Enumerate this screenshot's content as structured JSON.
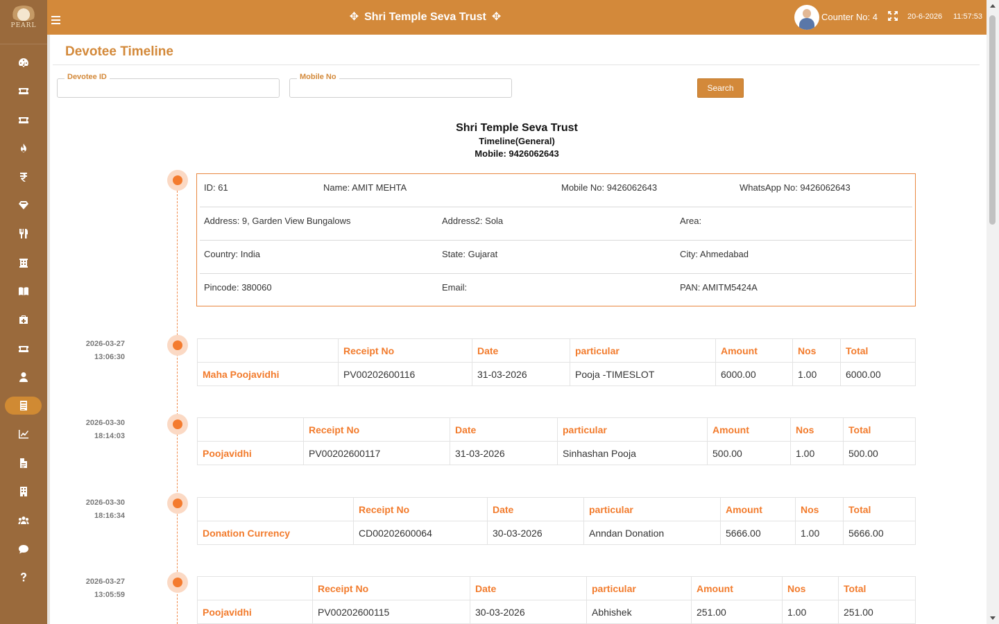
{
  "app": {
    "logo_text": "PEARL",
    "brand_title": "Shri Temple Seva Trust",
    "counter": "Counter No: 4",
    "date": "20-6-2026",
    "time": "11:57:53"
  },
  "sidebar": {
    "items": [
      {
        "icon": "dashboard-icon"
      },
      {
        "icon": "ticket-icon"
      },
      {
        "icon": "ticket-alt-icon"
      },
      {
        "icon": "fire-icon"
      },
      {
        "icon": "rupee-icon"
      },
      {
        "icon": "gem-icon"
      },
      {
        "icon": "utensils-icon"
      },
      {
        "icon": "building-icon"
      },
      {
        "icon": "book-icon"
      },
      {
        "icon": "medkit-icon"
      },
      {
        "icon": "ticket-icon-2"
      },
      {
        "icon": "user-icon"
      },
      {
        "icon": "address-book-icon",
        "active": true
      },
      {
        "icon": "chart-icon"
      },
      {
        "icon": "file-icon"
      },
      {
        "icon": "office-building-icon"
      },
      {
        "icon": "users-icon"
      },
      {
        "icon": "comment-icon"
      },
      {
        "icon": "question-icon"
      }
    ]
  },
  "page": {
    "title": "Devotee Timeline"
  },
  "form": {
    "devotee_id_label": "Devotee ID",
    "devotee_id_value": "",
    "mobile_label": "Mobile No",
    "mobile_value": "",
    "search_label": "Search"
  },
  "report": {
    "org": "Shri Temple Seva Trust",
    "subtitle": "Timeline(General)",
    "mobile": "Mobile: 9426062643"
  },
  "devotee": {
    "id": "ID: 61",
    "name": "Name: AMIT MEHTA",
    "mobile": "Mobile No: 9426062643",
    "whatsapp": "WhatsApp No: 9426062643",
    "address": "Address: 9, Garden View Bungalows",
    "address2": "Address2: Sola",
    "area": "Area:",
    "country": "Country: India",
    "state": "State: Gujarat",
    "city": "City: Ahmedabad",
    "pincode": "Pincode: 380060",
    "email": "Email:",
    "pan": "PAN: AMITM5424A"
  },
  "columns": {
    "receipt": "Receipt No",
    "date": "Date",
    "particular": "particular",
    "amount": "Amount",
    "nos": "Nos",
    "total": "Total"
  },
  "entries": [
    {
      "stamp_date": "2026-03-27",
      "stamp_time": "13:06:30",
      "type": "Maha Poojavidhi",
      "receipt": "PV00202600116",
      "date": "31-03-2026",
      "particular": "Pooja -TIMESLOT",
      "amount": "6000.00",
      "nos": "1.00",
      "total": "6000.00"
    },
    {
      "stamp_date": "2026-03-30",
      "stamp_time": "18:14:03",
      "type": "Poojavidhi",
      "receipt": "PV00202600117",
      "date": "31-03-2026",
      "particular": "Sinhashan Pooja",
      "amount": "500.00",
      "nos": "1.00",
      "total": "500.00"
    },
    {
      "stamp_date": "2026-03-30",
      "stamp_time": "18:16:34",
      "type": "Donation Currency",
      "receipt": "CD00202600064",
      "date": "30-03-2026",
      "particular": "Anndan Donation",
      "amount": "5666.00",
      "nos": "1.00",
      "total": "5666.00"
    },
    {
      "stamp_date": "2026-03-27",
      "stamp_time": "13:05:59",
      "type": "Poojavidhi",
      "receipt": "PV00202600115",
      "date": "30-03-2026",
      "particular": "Abhishek",
      "amount": "251.00",
      "nos": "1.00",
      "total": "251.00"
    }
  ]
}
